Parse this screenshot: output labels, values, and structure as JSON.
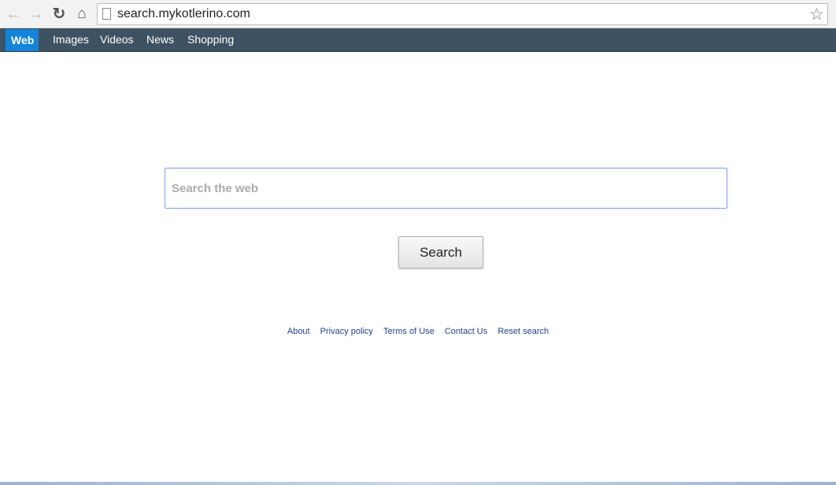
{
  "browser": {
    "url": "search.mykotlerino.com",
    "icons": [
      "back-arrow-icon",
      "forward-arrow-icon",
      "reload-icon",
      "home-icon",
      "page-icon",
      "star-icon"
    ]
  },
  "nav": {
    "items": [
      {
        "label": "Web",
        "active": true
      },
      {
        "label": "Images"
      },
      {
        "label": "Videos"
      },
      {
        "label": "News"
      },
      {
        "label": "Shopping"
      }
    ],
    "active_color": "#1384d8",
    "bar_color": "#3f5263"
  },
  "search": {
    "placeholder": "Search the web",
    "value": "",
    "button_label": "Search"
  },
  "footer": {
    "links": [
      "About",
      "Privacy policy",
      "Terms of Use",
      "Contact Us",
      "Reset search"
    ]
  }
}
